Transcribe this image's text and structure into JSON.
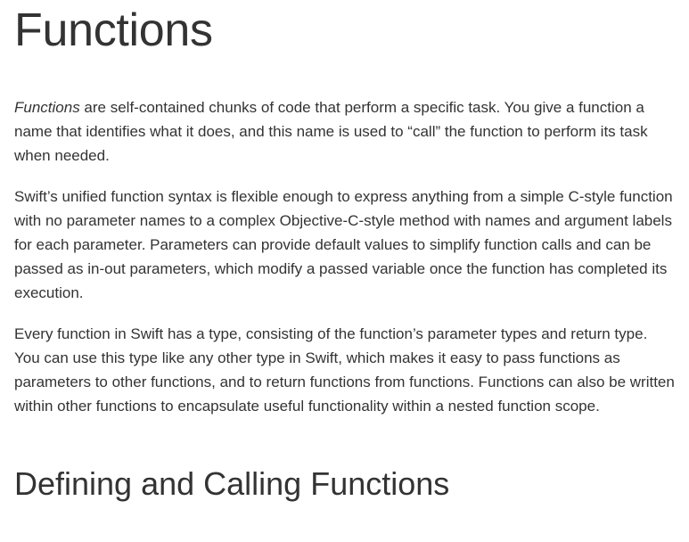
{
  "title": "Functions",
  "intro": {
    "term": "Functions",
    "rest": " are self-contained chunks of code that perform a specific task. You give a function a name that identifies what it does, and this name is used to “call” the function to perform its task when needed."
  },
  "paragraphs": [
    "Swift’s unified function syntax is flexible enough to express anything from a simple C-style function with no parameter names to a complex Objective-C-style method with names and argument labels for each parameter. Parameters can provide default values to simplify function calls and can be passed as in-out parameters, which modify a passed variable once the function has completed its execution.",
    "Every function in Swift has a type, consisting of the function’s parameter types and return type. You can use this type like any other type in Swift, which makes it easy to pass functions as parameters to other functions, and to return functions from functions. Functions can also be written within other functions to encapsulate useful functionality within a nested function scope."
  ],
  "section_heading": "Defining and Calling Functions"
}
